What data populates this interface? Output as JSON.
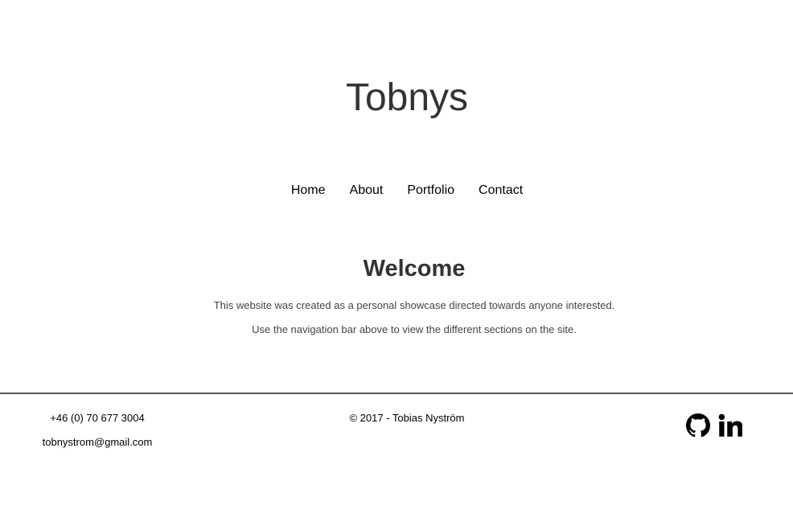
{
  "header": {
    "title": "Tobnys"
  },
  "nav": {
    "items": [
      {
        "label": "Home"
      },
      {
        "label": "About"
      },
      {
        "label": "Portfolio"
      },
      {
        "label": "Contact"
      }
    ]
  },
  "main": {
    "heading": "Welcome",
    "paragraphs": [
      "This website was created as a personal showcase directed towards anyone interested.",
      "Use the navigation bar above to view the different sections on the site."
    ]
  },
  "footer": {
    "phone": "+46 (0) 70 677 3004",
    "email": "tobnystrom@gmail.com",
    "copyright": "© 2017 - Tobias Nyström",
    "icons": [
      "github-icon",
      "linkedin-icon"
    ]
  }
}
